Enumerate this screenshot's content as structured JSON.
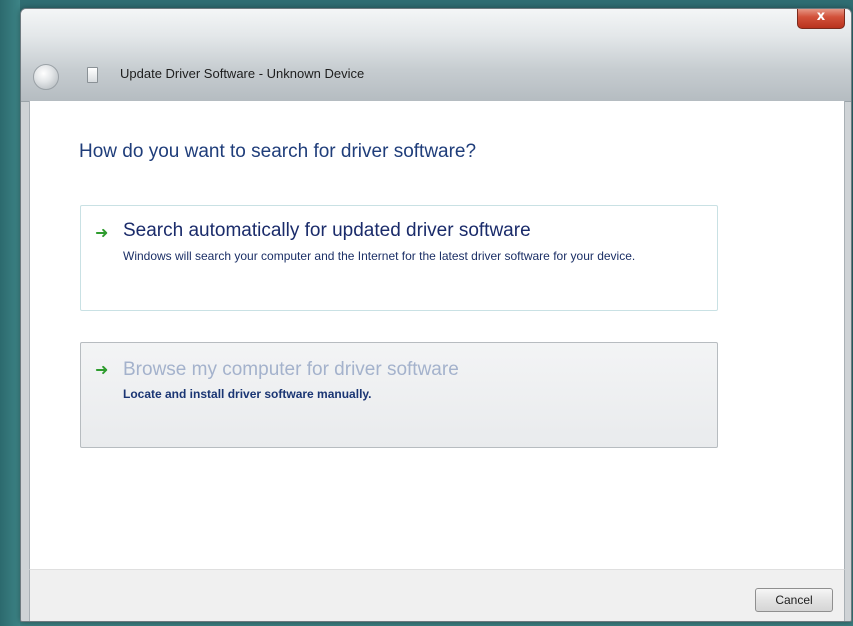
{
  "window": {
    "title": "Update Driver Software - Unknown Device",
    "close_glyph": "x"
  },
  "heading": "How do you want to search for driver software?",
  "options": [
    {
      "icon": "green-arrow-icon",
      "title": "Search automatically for updated driver software",
      "description": "Windows will search your computer and the Internet for the latest driver software for your device."
    },
    {
      "icon": "green-arrow-icon",
      "title": "Browse my computer for driver software",
      "description": "Locate and install driver software manually."
    }
  ],
  "footer": {
    "cancel_label": "Cancel"
  },
  "colors": {
    "heading": "#1f3d7a",
    "link_text": "#1a2b6a",
    "hover_link_text": "#a4b2cc",
    "arrow": "#2e9c2e"
  }
}
